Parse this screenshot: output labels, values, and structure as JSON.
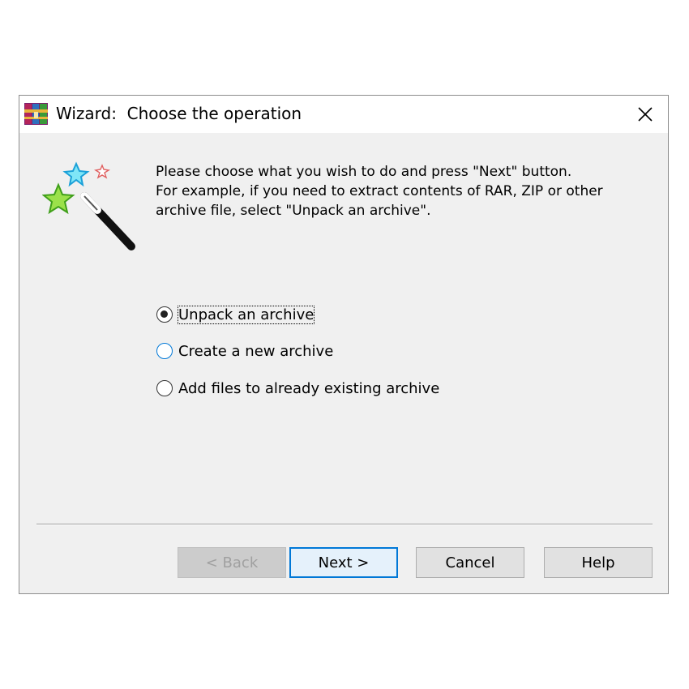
{
  "window": {
    "title": "Wizard:  Choose the operation",
    "app_icon": "winrar-books-icon",
    "close_icon": "close-icon"
  },
  "illustration": {
    "icon": "magic-wand-stars-icon"
  },
  "intro": {
    "line1": "Please choose what you wish to do and press \"Next\" button.",
    "line2": "For example, if you need to extract contents of RAR, ZIP or other",
    "line3": "archive file, select \"Unpack an archive\"."
  },
  "options": [
    {
      "label": "Unpack an archive",
      "checked": true
    },
    {
      "label": "Create a new archive",
      "checked": false
    },
    {
      "label": "Add files to already existing archive",
      "checked": false
    }
  ],
  "buttons": {
    "back": "< Back",
    "next": "Next >",
    "cancel": "Cancel",
    "help": "Help"
  },
  "colors": {
    "accent": "#0078d7",
    "dialog_bg": "#f0f0f0",
    "disabled_text": "#a0a0a0"
  }
}
